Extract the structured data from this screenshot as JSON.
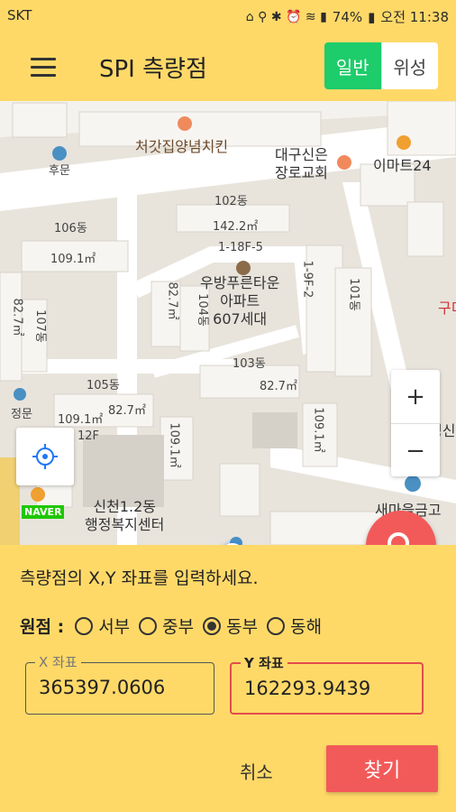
{
  "status": {
    "carrier": "SKT",
    "battery": "74%",
    "time": "오전 11:38"
  },
  "header": {
    "title": "SPI 측량점",
    "map_type": {
      "normal": "일반",
      "satellite": "위성",
      "selected": "일반"
    }
  },
  "map": {
    "labels": {
      "restaurant": "처갓집양념치킨",
      "church": "대구신은\n장로교회",
      "mart": "이마트24",
      "back_gate": "후문",
      "main_gate": "정문",
      "apartment": "우방푸른타운\n아파트\n607세대",
      "community": "신천1.2동\n행정복지센터",
      "bank": "새마을금고",
      "b106": "106동",
      "b102": "102동",
      "b107": "107동",
      "b104": "104동",
      "b101": "101동",
      "b105": "105동",
      "b103": "103동",
      "lot_18f5": "1-18F-5",
      "lot_9f2": "1-9F-2",
      "lot_12f": "12F",
      "a1": "109.1㎡",
      "a2": "142.2㎡",
      "a3": "82.7㎡",
      "a4": "82.7㎡",
      "a5": "82.7㎡",
      "a6": "109.1㎡",
      "a7": "82.7㎡",
      "a8": "109.1㎡",
      "a9": "109.1㎡",
      "edge1": "구미",
      "edge2": "명신"
    },
    "zoom_in": "+",
    "zoom_out": "−",
    "brand": "NAVER",
    "icons": [
      "locate-icon",
      "search-icon"
    ]
  },
  "form": {
    "instruction": "측량점의 X,Y 좌표를 입력하세요.",
    "origin_label": "원점 :",
    "origins": [
      "서부",
      "중부",
      "동부",
      "동해"
    ],
    "origin_selected": "동부",
    "x_label": "X 좌표",
    "x_value": "365397.0606",
    "y_label": "Y 좌표",
    "y_value": "162293.9439",
    "cancel": "취소",
    "find": "찾기"
  },
  "colors": {
    "accent": "#FFD968",
    "toggle_on": "#1DCC6A",
    "action": "#F25A5A",
    "location": "#2177F5"
  }
}
